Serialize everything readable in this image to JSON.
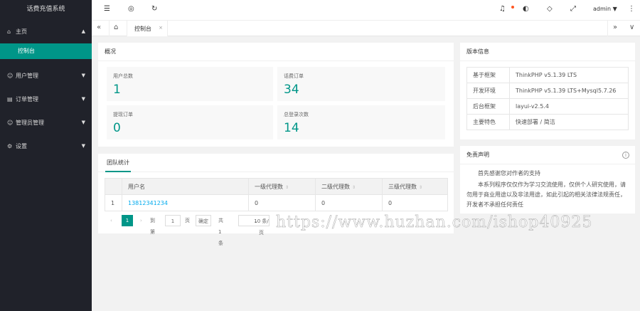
{
  "app": {
    "title": "话费充值系统"
  },
  "colors": {
    "accent": "#009688",
    "sidebar_bg": "#20222a",
    "link": "#01aaed",
    "badge": "#ff5722"
  },
  "sidebar": {
    "items": [
      {
        "label": "主页",
        "icon": "home-icon",
        "expanded": true,
        "children": [
          {
            "label": "控制台",
            "active": true
          }
        ]
      },
      {
        "label": "用户管理",
        "icon": "user-icon"
      },
      {
        "label": "订单管理",
        "icon": "order-icon"
      },
      {
        "label": "管理员管理",
        "icon": "admin-icon"
      },
      {
        "label": "设置",
        "icon": "gear-icon"
      }
    ]
  },
  "header": {
    "icons": [
      "menu-fold-icon",
      "globe-icon",
      "refresh-icon",
      "bell-icon",
      "theme-icon",
      "tag-icon",
      "fullscreen-icon",
      "more-icon"
    ],
    "user": "admin"
  },
  "tabs": {
    "active": "控制台"
  },
  "overview": {
    "title": "概况",
    "stats": [
      {
        "label": "用户总数",
        "value": "1"
      },
      {
        "label": "话费订单",
        "value": "34"
      },
      {
        "label": "提现订单",
        "value": "0"
      },
      {
        "label": "总登录次数",
        "value": "14"
      }
    ]
  },
  "version": {
    "title": "版本信息",
    "rows": [
      {
        "k": "基于框架",
        "v": "ThinkPHP v5.1.39 LTS"
      },
      {
        "k": "开发环境",
        "v": "ThinkPHP v5.1.39 LTS+Mysql5.7.26"
      },
      {
        "k": "后台框架",
        "v": "layui-v2.5.4"
      },
      {
        "k": "主要特色",
        "v": "快速部署 / 简洁"
      }
    ]
  },
  "team": {
    "tab": "团队统计",
    "columns": [
      "用户名",
      "一级代理数",
      "二级代理数",
      "三级代理数"
    ],
    "rows": [
      {
        "idx": "1",
        "user": "13812341234",
        "l1": "0",
        "l2": "0",
        "l3": "0"
      }
    ],
    "pager": {
      "prev": "‹",
      "current": "1",
      "next": "›",
      "goto": "到第",
      "page_input": "1",
      "page_unit": "页",
      "confirm": "确定",
      "total": "共 1 条",
      "per_page": "10 条/页"
    }
  },
  "disclaimer": {
    "title": "免责声明",
    "p1": "首先感谢您对作者的支持",
    "p2": "本系列程序仅仅作为学习交流使用，仅供个人研究使用，请勿用于商业用途以及非法用途，如此引起的相关法律法规责任，开发者不承担任何责任"
  },
  "watermark": "https://www.huzhan.com/ishop40925"
}
